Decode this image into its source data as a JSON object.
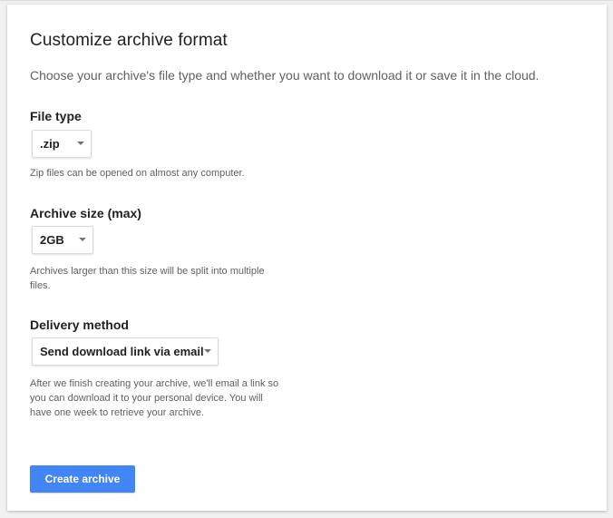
{
  "header": {
    "title": "Customize archive format",
    "description": "Choose your archive's file type and whether you want to download it or save it in the cloud."
  },
  "file_type": {
    "label": "File type",
    "selected": ".zip",
    "help": "Zip files can be opened on almost any computer."
  },
  "archive_size": {
    "label": "Archive size (max)",
    "selected": "2GB",
    "help_line1": "Archives larger than this size will be split into multiple",
    "help_line2": "files."
  },
  "delivery": {
    "label": "Delivery method",
    "selected": "Send download link via email",
    "help_line1": "After we finish creating your archive, we'll email a link so",
    "help_line2": "you can download it to your personal device. You will",
    "help_line3": "have one week to retrieve your archive."
  },
  "actions": {
    "create_label": "Create archive"
  },
  "colors": {
    "accent": "#4285f4",
    "background": "#f1f1f1",
    "card": "#ffffff"
  },
  "icons": {
    "dropdown": "caret-down-icon"
  }
}
